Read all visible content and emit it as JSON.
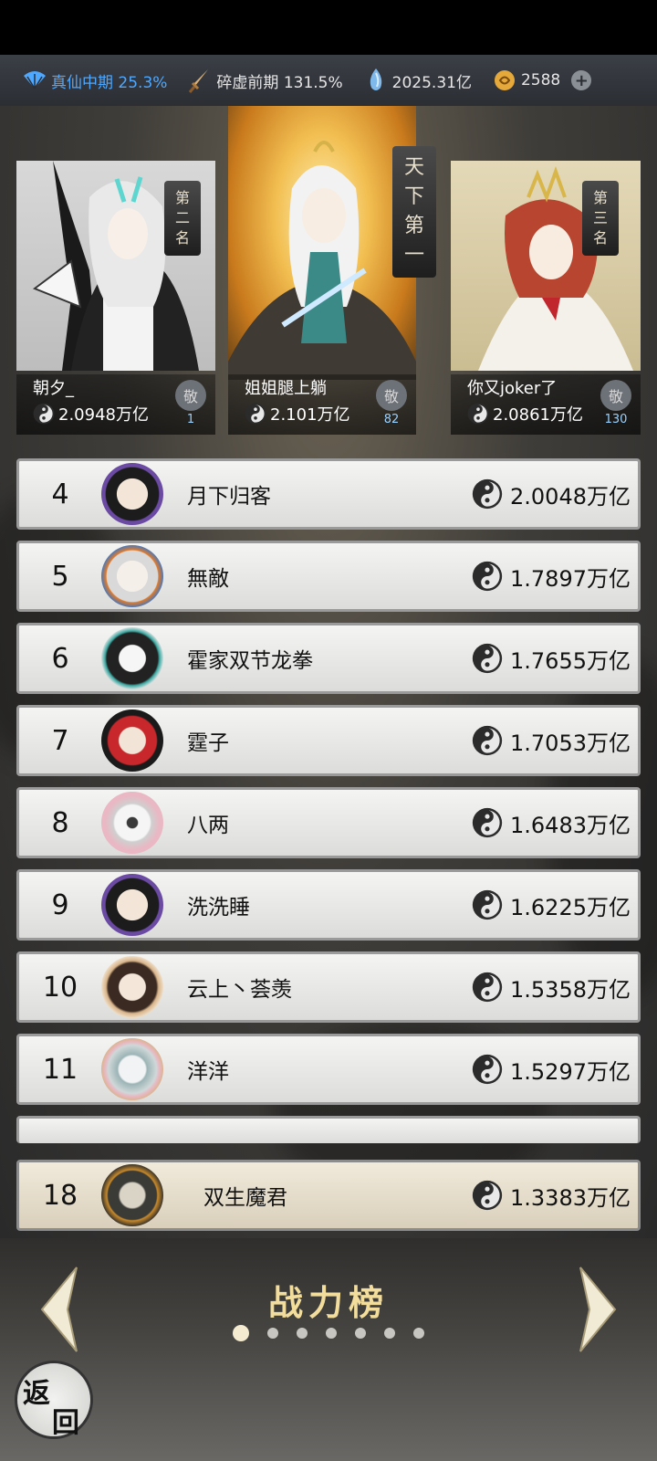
{
  "resources": {
    "cultivation": "真仙中期 25.3%",
    "body": "碎虚前期 131.5%",
    "spirit_stones": "2025.31亿",
    "gold": "2588"
  },
  "podium": {
    "second": {
      "banner": "第二名",
      "name": "朝夕_",
      "power": "2.0948万亿",
      "worship_icon": "敬",
      "worship_count": "1"
    },
    "first": {
      "banner": "天下第一",
      "name": "姐姐腿上躺",
      "power": "2.101万亿",
      "worship_icon": "敬",
      "worship_count": "82"
    },
    "third": {
      "banner": "第三名",
      "name": "你又joker了",
      "power": "2.0861万亿",
      "worship_icon": "敬",
      "worship_count": "130"
    }
  },
  "rankings": [
    {
      "rank": "4",
      "name": "月下归客",
      "power": "2.0048万亿"
    },
    {
      "rank": "5",
      "name": "無敵",
      "power": "1.7897万亿"
    },
    {
      "rank": "6",
      "name": "霍家双节龙拳",
      "power": "1.7655万亿"
    },
    {
      "rank": "7",
      "name": "霆子",
      "power": "1.7053万亿"
    },
    {
      "rank": "8",
      "name": "八两",
      "power": "1.6483万亿"
    },
    {
      "rank": "9",
      "name": "洗洗睡",
      "power": "1.6225万亿"
    },
    {
      "rank": "10",
      "name": "云上丶荟羡",
      "power": "1.5358万亿"
    },
    {
      "rank": "11",
      "name": "洋洋",
      "power": "1.5297万亿"
    }
  ],
  "my_rank": {
    "rank": "18",
    "name": "双生魔君",
    "power": "1.3383万亿"
  },
  "board_title": "战力榜",
  "page_count": 7,
  "active_page": 1,
  "back_label": "返回"
}
